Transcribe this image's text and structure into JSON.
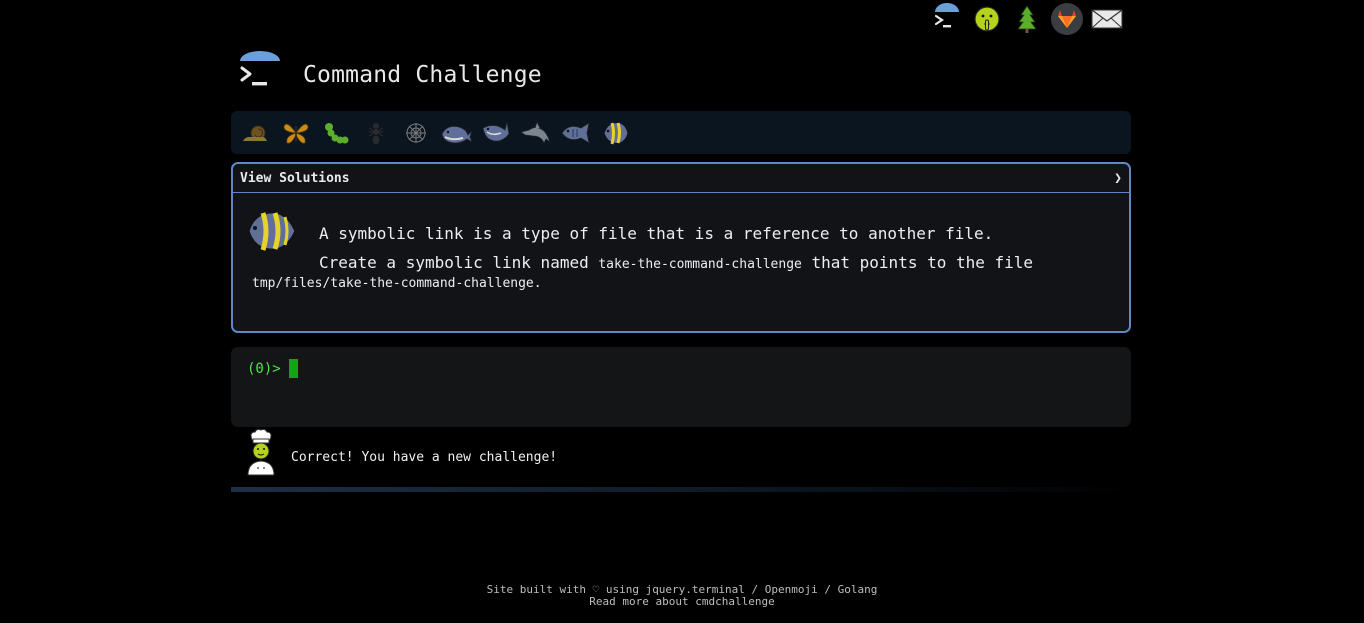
{
  "app": {
    "title": "Command Challenge"
  },
  "topnav": {
    "icons": [
      "terminal-icon",
      "shushing-face-icon",
      "tree-icon",
      "gitlab-icon",
      "envelope-icon"
    ]
  },
  "levels": {
    "icons": [
      "snail-icon",
      "butterfly-icon",
      "caterpillar-icon",
      "ant-icon",
      "spider-web-icon",
      "whale-icon",
      "shark-icon",
      "dolphin-icon",
      "fish-icon",
      "tropical-fish-icon"
    ]
  },
  "challenge": {
    "solutions_label": "View Solutions",
    "chevron": "❯",
    "line1": "A symbolic link is a type of file that is a reference to another file.",
    "line2_prefix": "Create a symbolic link named ",
    "line2_code": "take-the-command-challenge",
    "line2_suffix": " that points to the file",
    "line3_code": "tmp/files/take-the-command-challenge."
  },
  "terminal": {
    "prompt": "(0)>"
  },
  "message": {
    "text": "Correct! You have a new challenge!"
  },
  "footer": {
    "line1": "Site built with ♡ using jquery.terminal / Openmoji / Golang",
    "line2": "Read more about cmdchallenge"
  },
  "colors": {
    "accent_blue": "#5f88c4",
    "prompt_green": "#52e34a",
    "cursor_green": "#16a318",
    "levelbar_bg": "#0b1520",
    "panel_bg": "#111317"
  }
}
